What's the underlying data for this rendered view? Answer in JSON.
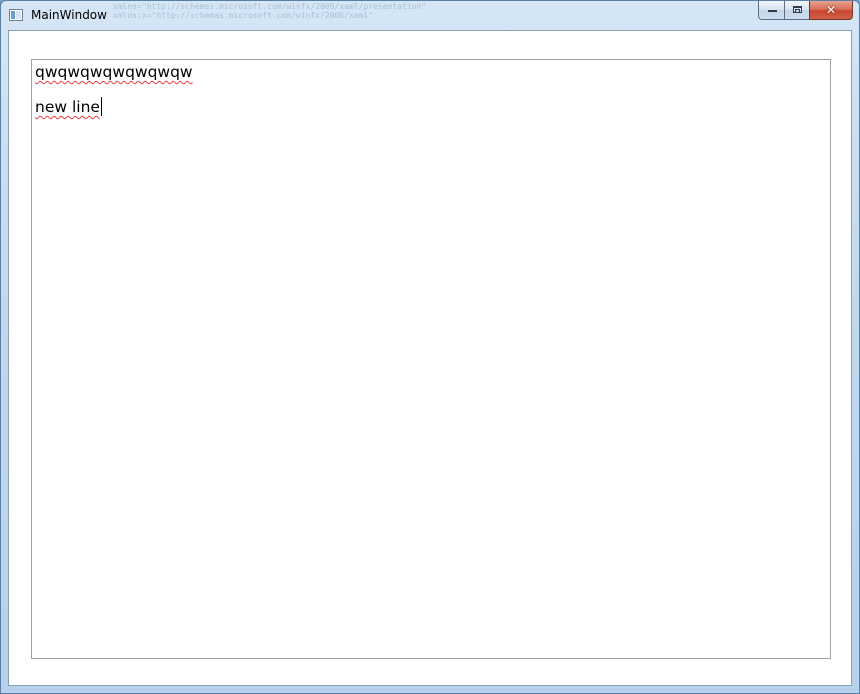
{
  "window": {
    "title": "MainWindow",
    "ghost_lines": [
      "xmlns=\"http://schemas.microsoft.com/winfx/2006/xaml/presentation\"",
      "xmlns:x=\"http://schemas.microsoft.com/winfx/2006/xaml\""
    ],
    "caption_buttons": {
      "minimize_icon": "minimize-icon",
      "maximize_icon": "maximize-icon",
      "close_glyph": "✕"
    },
    "colors": {
      "close_button": "#c8442d",
      "titlebar": "#c2d9ef",
      "spell_underline": "#e23b3b"
    }
  },
  "editor": {
    "lines": [
      "qwqwqwqwqwqwqw",
      "new line"
    ]
  }
}
